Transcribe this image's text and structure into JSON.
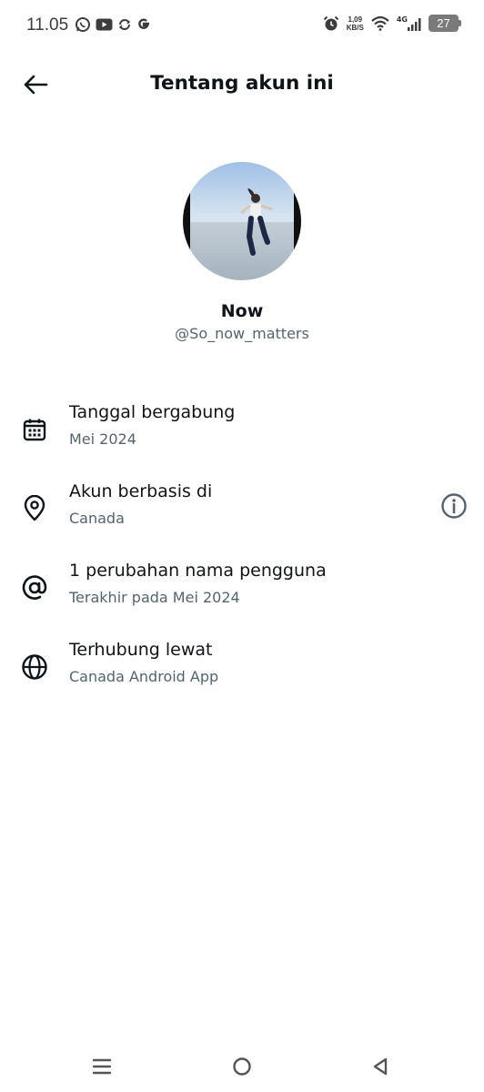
{
  "status_bar": {
    "time": "11.05",
    "left_icons": [
      "whatsapp-icon",
      "youtube-icon",
      "sync-icon",
      "google-icon"
    ],
    "net_speed_value": "1,09",
    "net_speed_unit": "KB/S",
    "network_type": "4G",
    "battery": "27"
  },
  "header": {
    "title": "Tentang akun ini",
    "back_icon": "arrow-left-icon"
  },
  "profile": {
    "name": "Now",
    "handle": "@So_now_matters"
  },
  "info_rows": [
    {
      "icon": "calendar-icon",
      "title": "Tanggal bergabung",
      "subtitle": "Mei 2024"
    },
    {
      "icon": "location-pin-icon",
      "title": "Akun berbasis di",
      "subtitle": "Canada",
      "action_icon": "info-icon"
    },
    {
      "icon": "at-sign-icon",
      "title": "1 perubahan nama pengguna",
      "subtitle": "Terakhir pada Mei 2024"
    },
    {
      "icon": "globe-icon",
      "title": "Terhubung lewat",
      "subtitle": "Canada Android App"
    }
  ],
  "nav_bar": {
    "buttons": [
      "menu-icon",
      "home-circle-icon",
      "back-triangle-icon"
    ]
  },
  "colors": {
    "text_primary": "#0f1419",
    "text_secondary": "#536471",
    "background": "#ffffff"
  }
}
